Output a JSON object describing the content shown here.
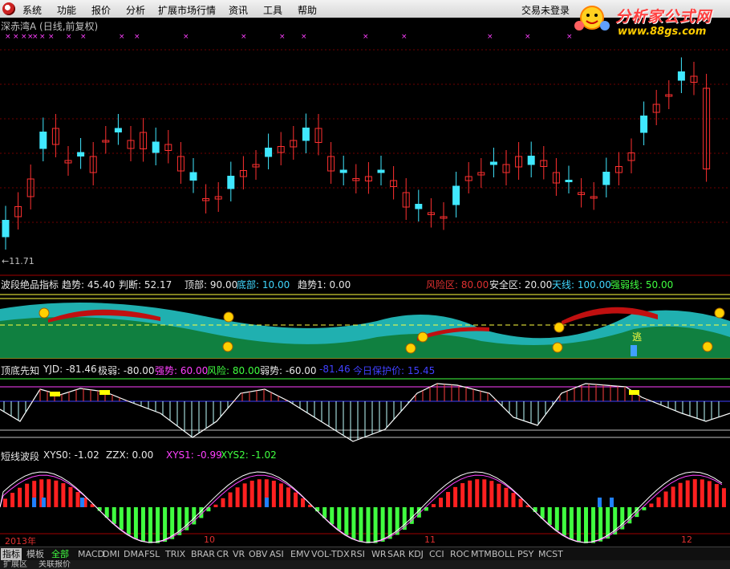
{
  "menu": {
    "items": [
      "系统",
      "功能",
      "报价",
      "分析",
      "扩展市场行情",
      "资讯",
      "工具",
      "帮助"
    ],
    "login": "交易未登录"
  },
  "brand": {
    "name": "分析家公式网",
    "url": "www.88gs.com"
  },
  "stock": {
    "title": "深赤湾A (日线,前复权)",
    "low_label": "←11.71"
  },
  "panel1": {
    "name": "波段绝品指标",
    "trend": "趋势: 45.40",
    "judge": "判断: 52.17",
    "top": "顶部: 90.00",
    "bottom": "底部: 10.00",
    "trend1": "趋势1: 0.00",
    "risk": "风险区: 80.00",
    "safe": "安全区: 20.00",
    "sky": "天线: 100.00",
    "strong": "强弱线: 50.00",
    "escape": "逃"
  },
  "panel2": {
    "name": "顶底先知",
    "yjd": "YJD: -81.46",
    "ext": "极弱: -80.00",
    "strong": "强势: 60.00",
    "risk": "风险: 80.00",
    "weak": "弱势: -60.00",
    "val": "-81.46",
    "protect": "今日保护价: 15.45"
  },
  "panel3": {
    "name": "短线波段",
    "xys0": "XYS0: -1.02",
    "zzx": "ZZX: 0.00",
    "xys1": "XYS1: -0.99",
    "xys2": "XYS2: -1.02"
  },
  "axis": {
    "labels": [
      "2013年",
      "10",
      "11",
      "12"
    ]
  },
  "tabs": [
    "指标",
    "模板",
    "全部",
    "MACD",
    "DMI",
    "DMA",
    "FSL",
    "TRIX",
    "BRAR",
    "CR",
    "VR",
    "OBV",
    "ASI",
    "EMV",
    "VOL-TDX",
    "RSI",
    "WR",
    "SAR",
    "KDJ",
    "CCI",
    "ROC",
    "MTM",
    "BOLL",
    "PSY",
    "MCST"
  ],
  "bottom": {
    "ext": "扩展区",
    "quote": "关联报价"
  },
  "colors": {
    "up": "#ff3030",
    "down": "#40e8ff",
    "green": "#00ff00",
    "teal": "#00c0c0"
  }
}
